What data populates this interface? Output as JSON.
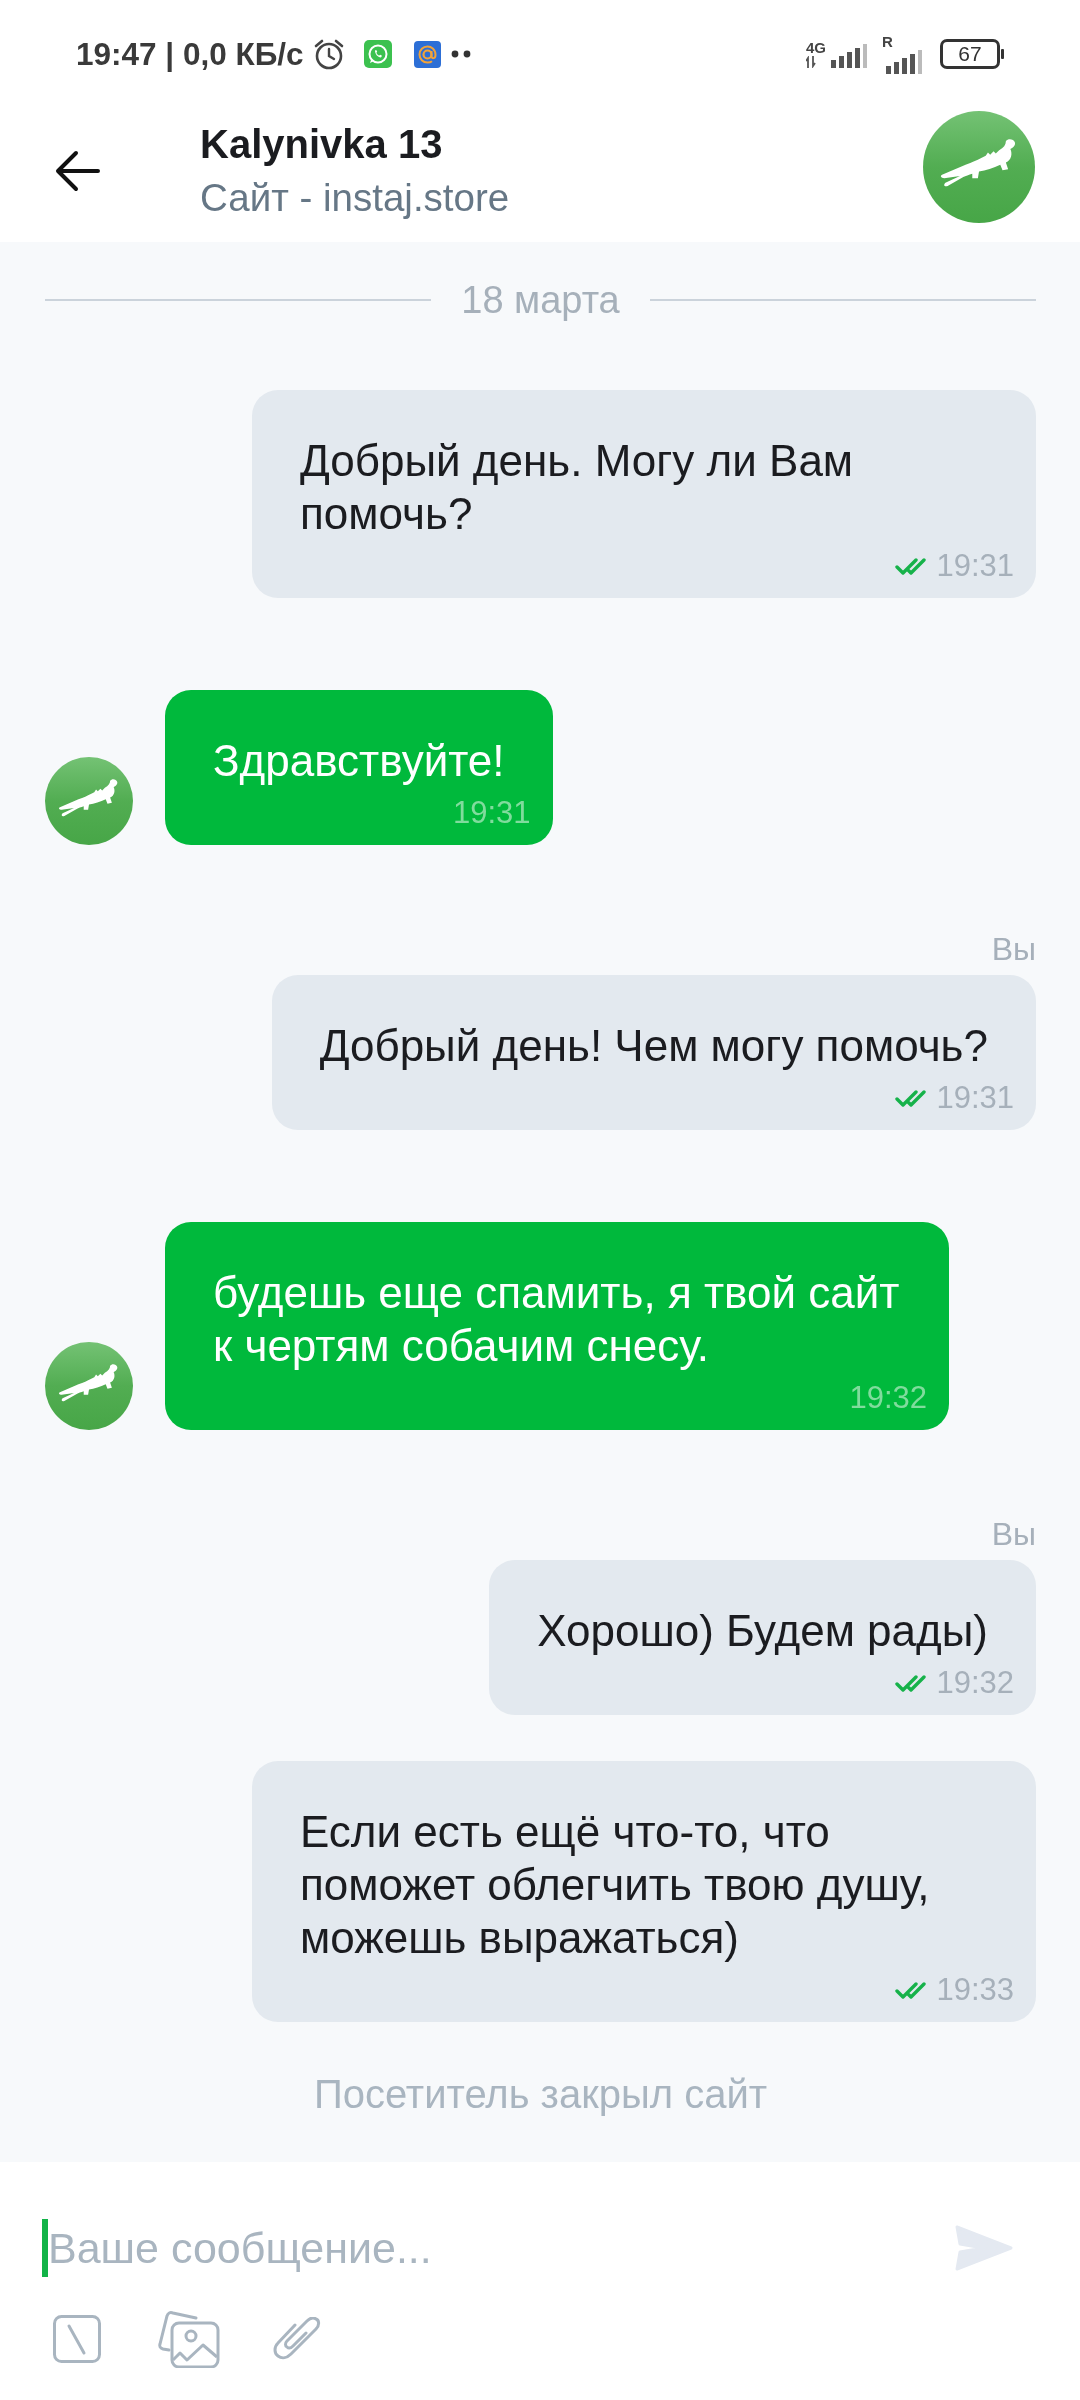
{
  "status_bar": {
    "time": "19:47 | 0,0 КБ/с",
    "network_1_label": "4G",
    "network_2_label": "R",
    "battery": "67"
  },
  "header": {
    "title": "Kalynivka 13",
    "subtitle": "Сайт - instaj.store"
  },
  "timeline": [
    {
      "kind": "date",
      "text": "18 марта"
    },
    {
      "kind": "outgoing",
      "text": "Добрый день. Могу ли Вам помочь?",
      "time": "19:31",
      "read": true
    },
    {
      "kind": "incoming",
      "text": "Здравствуйте!",
      "time": "19:31"
    },
    {
      "kind": "outgoing",
      "sender": "Вы",
      "text": "Добрый день! Чем могу помочь?",
      "time": "19:31",
      "read": true
    },
    {
      "kind": "incoming",
      "text": "будешь еще спамить, я твой сайт к чертям собачим снесу.",
      "time": "19:32"
    },
    {
      "kind": "outgoing",
      "sender": "Вы",
      "text": "Хорошо) Будем рады)",
      "time": "19:32",
      "read": true
    },
    {
      "kind": "outgoing",
      "text": "Если есть ещё что-то, что поможет облегчить твою душу, можешь выражаться)",
      "time": "19:33",
      "read": true
    },
    {
      "kind": "system",
      "text": "Посетитель закрыл сайт"
    }
  ],
  "composer": {
    "placeholder": "Ваше сообщение...",
    "focused": true,
    "send_disabled": true
  }
}
